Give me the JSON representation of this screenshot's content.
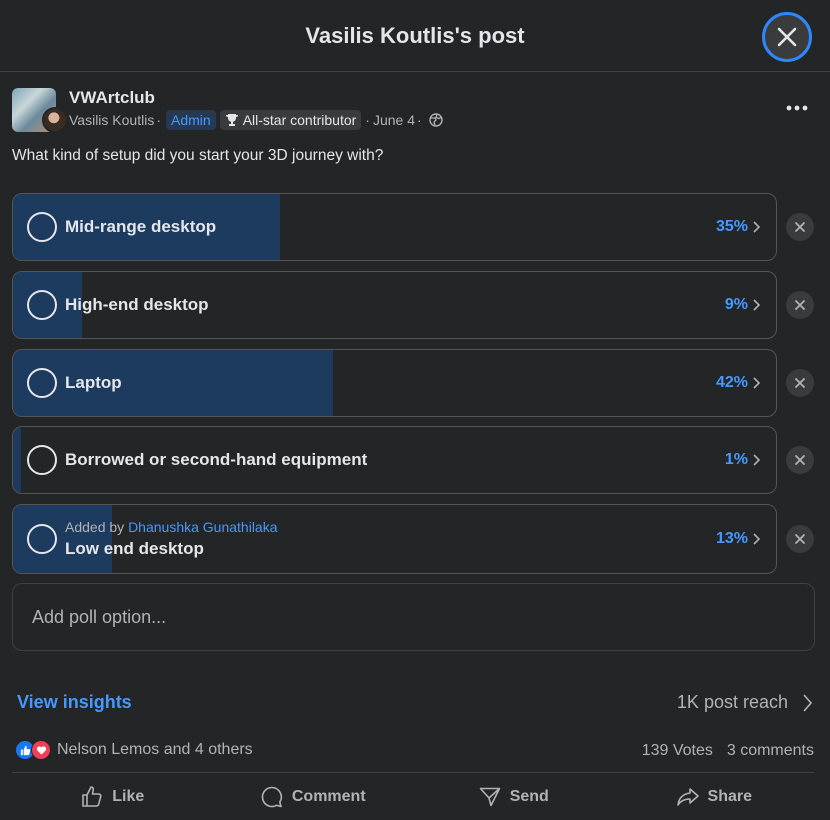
{
  "header": {
    "title": "Vasilis Koutlis's post"
  },
  "post": {
    "group_name": "VWArtclub",
    "author": "Vasilis Koutlis",
    "dot": "·",
    "admin_badge": "Admin",
    "contributor_badge": "All-star contributor",
    "date": "June 4",
    "question": "What kind of setup did you start your 3D journey with?"
  },
  "poll": {
    "options": [
      {
        "label": "Mid-range desktop",
        "percent_text": "35%",
        "percent": 35
      },
      {
        "label": "High-end desktop",
        "percent_text": "9%",
        "percent": 9
      },
      {
        "label": "Laptop",
        "percent_text": "42%",
        "percent": 42
      },
      {
        "label": "Borrowed or second-hand equipment",
        "percent_text": "1%",
        "percent": 1
      },
      {
        "label": "Low end desktop",
        "percent_text": "13%",
        "percent": 13,
        "added_by_prefix": "Added by",
        "added_by_name": "Dhanushka Gunathilaka"
      }
    ],
    "add_option_placeholder": "Add poll option..."
  },
  "insights": {
    "label": "View insights",
    "reach": "1K post reach"
  },
  "engagement": {
    "reactions_text": "Nelson Lemos and 4 others",
    "votes": "139 Votes",
    "comments": "3 comments"
  },
  "actions": {
    "like": "Like",
    "comment": "Comment",
    "send": "Send",
    "share": "Share"
  },
  "colors": {
    "background": "#242526",
    "accent": "#4599ff",
    "poll_fill": "#1d3a5f",
    "like": "#1877f2",
    "love": "#f33e58"
  },
  "icons": [
    "close-icon",
    "more-icon",
    "trophy-icon",
    "globe-icon",
    "chevron-right-icon",
    "like-icon",
    "comment-icon",
    "send-icon",
    "share-icon"
  ]
}
